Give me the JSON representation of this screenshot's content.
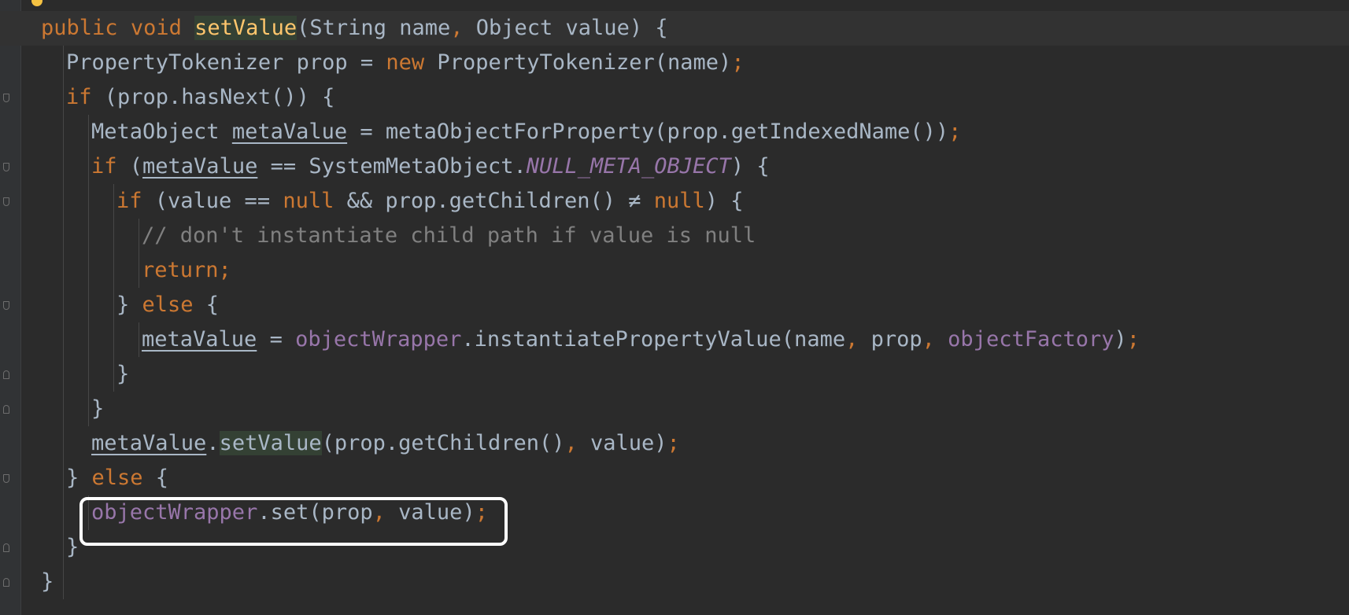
{
  "editor": {
    "language": "Java",
    "theme": "Darcula",
    "colors": {
      "background": "#2b2b2b",
      "keyword": "#cc7832",
      "method_declaration": "#ffc66d",
      "field": "#9876aa",
      "comment": "#808080",
      "default_text": "#a9b7c6",
      "highlight_box": "#ffffff"
    },
    "lines": [
      {
        "tokens": [
          {
            "t": "public",
            "c": "kw"
          },
          {
            "t": " "
          },
          {
            "t": "void",
            "c": "kw"
          },
          {
            "t": " "
          },
          {
            "t": "setValue",
            "c": "fn hl-decl"
          },
          {
            "t": "(String name"
          },
          {
            "t": ",",
            "c": "punc"
          },
          {
            "t": " Object value) {"
          }
        ]
      },
      {
        "tokens": [
          {
            "t": "PropertyTokenizer prop = "
          },
          {
            "t": "new",
            "c": "kw"
          },
          {
            "t": " PropertyTokenizer(name)"
          },
          {
            "t": ";",
            "c": "punc"
          }
        ]
      },
      {
        "tokens": [
          {
            "t": "if",
            "c": "kw"
          },
          {
            "t": " (prop.hasNext()) {"
          }
        ]
      },
      {
        "tokens": [
          {
            "t": "MetaObject "
          },
          {
            "t": "metaValue",
            "c": "uvar"
          },
          {
            "t": " = metaObjectForProperty(prop.getIndexedName())"
          },
          {
            "t": ";",
            "c": "punc"
          }
        ]
      },
      {
        "tokens": [
          {
            "t": "if",
            "c": "kw"
          },
          {
            "t": " ("
          },
          {
            "t": "metaValue",
            "c": "uvar"
          },
          {
            "t": " == SystemMetaObject."
          },
          {
            "t": "NULL_META_OBJECT",
            "c": "const"
          },
          {
            "t": ") {"
          }
        ]
      },
      {
        "tokens": [
          {
            "t": "if",
            "c": "kw"
          },
          {
            "t": " (value == "
          },
          {
            "t": "null",
            "c": "kw"
          },
          {
            "t": " && prop.getChildren() ≠ "
          },
          {
            "t": "null",
            "c": "kw"
          },
          {
            "t": ") {"
          }
        ]
      },
      {
        "tokens": [
          {
            "t": "// don't instantiate child path if value is null",
            "c": "cmt"
          }
        ]
      },
      {
        "tokens": [
          {
            "t": "return",
            "c": "kw"
          },
          {
            "t": ";",
            "c": "punc"
          }
        ]
      },
      {
        "tokens": [
          {
            "t": "} "
          },
          {
            "t": "else",
            "c": "kw"
          },
          {
            "t": " {"
          }
        ]
      },
      {
        "tokens": [
          {
            "t": "metaValue",
            "c": "uvar"
          },
          {
            "t": " = "
          },
          {
            "t": "objectWrapper",
            "c": "fld"
          },
          {
            "t": ".instantiatePropertyValue(name"
          },
          {
            "t": ",",
            "c": "punc"
          },
          {
            "t": " prop"
          },
          {
            "t": ",",
            "c": "punc"
          },
          {
            "t": " "
          },
          {
            "t": "objectFactory",
            "c": "fld"
          },
          {
            "t": ")"
          },
          {
            "t": ";",
            "c": "punc"
          }
        ]
      },
      {
        "tokens": [
          {
            "t": "}"
          }
        ]
      },
      {
        "tokens": [
          {
            "t": "}"
          }
        ]
      },
      {
        "tokens": [
          {
            "t": "metaValue",
            "c": "uvar"
          },
          {
            "t": "."
          },
          {
            "t": "setValue",
            "c": "hl-use"
          },
          {
            "t": "(prop.getChildren()"
          },
          {
            "t": ",",
            "c": "punc"
          },
          {
            "t": " value)"
          },
          {
            "t": ";",
            "c": "punc"
          }
        ]
      },
      {
        "tokens": [
          {
            "t": "} "
          },
          {
            "t": "else",
            "c": "kw"
          },
          {
            "t": " {"
          }
        ]
      },
      {
        "tokens": [
          {
            "t": "objectWrapper",
            "c": "fld"
          },
          {
            "t": ".set(prop"
          },
          {
            "t": ",",
            "c": "punc"
          },
          {
            "t": " value)"
          },
          {
            "t": ";",
            "c": "punc"
          }
        ]
      },
      {
        "tokens": [
          {
            "t": "}"
          }
        ]
      },
      {
        "tokens": [
          {
            "t": "}"
          }
        ]
      }
    ]
  }
}
